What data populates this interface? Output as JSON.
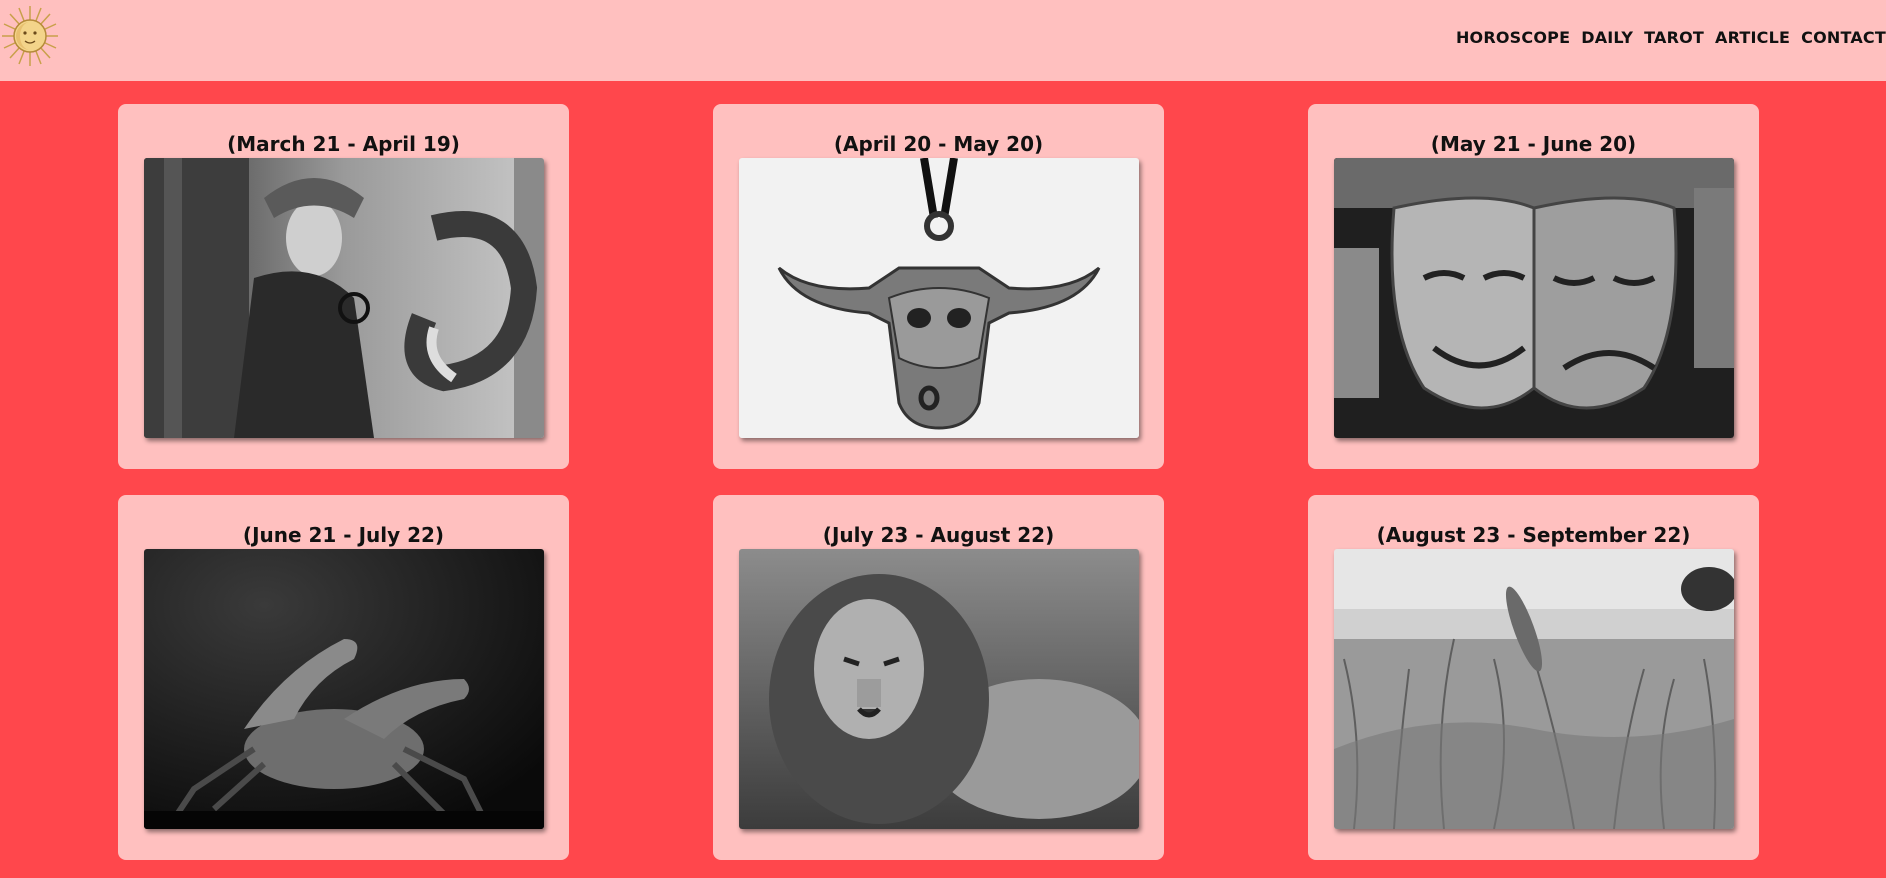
{
  "header": {
    "logo_name": "sun-logo",
    "nav": [
      {
        "label": "HOROSCOPE"
      },
      {
        "label": "DAILY"
      },
      {
        "label": "TAROT"
      },
      {
        "label": "ARTICLE"
      },
      {
        "label": "CONTACT"
      }
    ]
  },
  "signs": [
    {
      "dates": "(March 21 - April 19)",
      "image": "ram-horn-woman-photo"
    },
    {
      "dates": "(April 20 - May 20)",
      "image": "bull-skull-pendant-photo"
    },
    {
      "dates": "(May 21 - June 20)",
      "image": "theater-masks-photo"
    },
    {
      "dates": "(June 21 - July 22)",
      "image": "crab-photo"
    },
    {
      "dates": "(July 23 - August 22)",
      "image": "lion-photo"
    },
    {
      "dates": "(August 23 - September 22)",
      "image": "wheat-field-photo"
    }
  ],
  "colors": {
    "background": "#ff474c",
    "header": "#ffc0bf",
    "card": "#ffc0bf",
    "text": "#111111"
  }
}
